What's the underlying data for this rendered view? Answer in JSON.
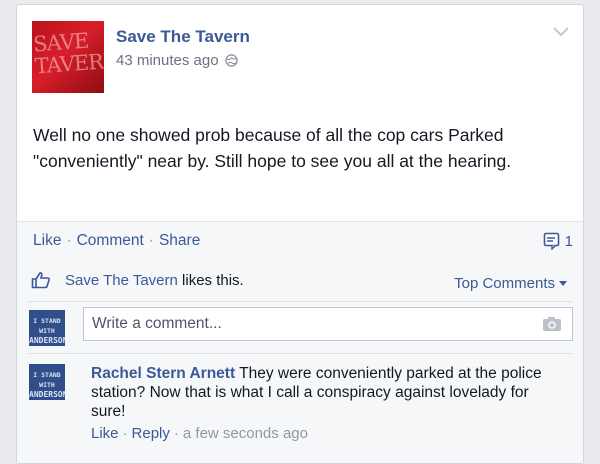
{
  "post": {
    "page_name": "Save The Tavern",
    "timestamp": "43 minutes ago",
    "privacy_icon": "globe-icon",
    "avatar_text": "SAVE TAVERN",
    "text": "Well no one showed prob because of all the cop cars Parked \"conveniently\" near by. Still hope to see you all at the hearing."
  },
  "actions": {
    "like": "Like",
    "comment": "Comment",
    "share": "Share",
    "separator": "·",
    "comment_count": "1"
  },
  "ufi": {
    "likes_name": "Save The Tavern",
    "likes_suffix": " likes this.",
    "top_comments": "Top Comments",
    "write_placeholder": "Write a comment...",
    "avatar_text_top": "I STAND WITH",
    "avatar_text_bottom": "ANDERSON"
  },
  "comments": [
    {
      "author": "Rachel Stern Arnett",
      "text": "They were conveniently parked at the police station? Now that is what I call a conspiracy against lovelady for sure!",
      "like": "Like",
      "reply": "Reply",
      "time": "a few seconds ago",
      "separator": "·"
    }
  ],
  "colors": {
    "link": "#3b5998",
    "background": "#e9ebee",
    "ufi_background": "#f6f7f9",
    "avatar_red": "#c8151e",
    "avatar_blue": "#2f4e8a"
  }
}
